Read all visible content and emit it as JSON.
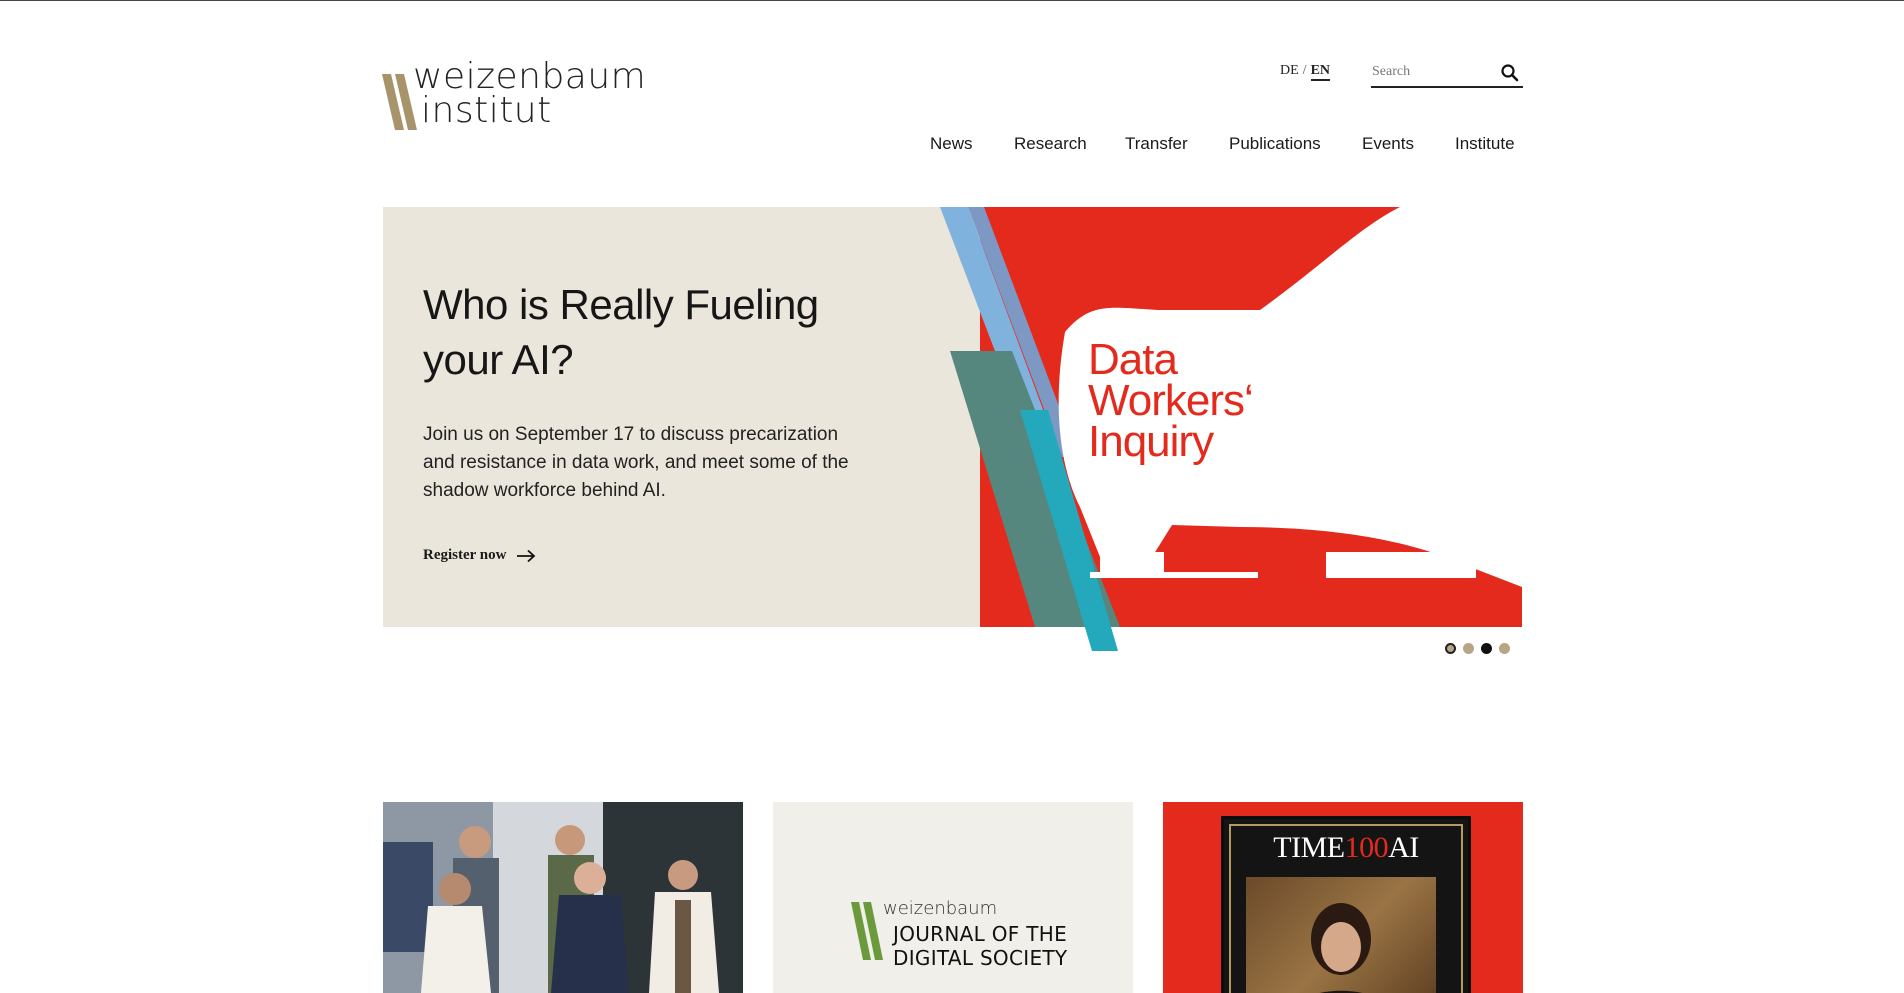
{
  "header": {
    "logo_line1": "weizenbaum",
    "logo_line2": "institut",
    "lang": {
      "de": "DE",
      "separator": "/",
      "en": "EN",
      "active": "EN"
    },
    "search": {
      "placeholder": "Search",
      "value": ""
    }
  },
  "nav": {
    "items": [
      {
        "label": "News"
      },
      {
        "label": "Research"
      },
      {
        "label": "Transfer"
      },
      {
        "label": "Publications"
      },
      {
        "label": "Events"
      },
      {
        "label": "Institute"
      }
    ]
  },
  "hero": {
    "title_line1": "Who is Really Fueling",
    "title_line2": "your AI?",
    "description": "Join us on September 17 to discuss precarization and resistance in data work, and meet some of the shadow workforce behind AI.",
    "cta_label": "Register now",
    "artwork_text": [
      "Data",
      "Workers‘",
      "Inquiry"
    ],
    "slider": {
      "total": 4,
      "current": 1
    }
  },
  "cards": {
    "journal": {
      "small": "weizenbaum",
      "line1": "JOURNAL OF THE",
      "line2": "DIGITAL SOCIETY"
    },
    "time": {
      "brand": "TIME",
      "number": "100",
      "suffix": "AI"
    }
  },
  "colors": {
    "brand_gold": "#a8946b",
    "hero_bg": "#ebe6dc",
    "accent_red": "#e42a1d",
    "teal": "#23a9bb",
    "journal_green": "#6a9a3c"
  }
}
